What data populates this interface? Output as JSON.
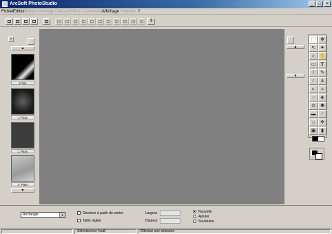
{
  "window": {
    "title": "ArcSoft PhotoStudio"
  },
  "menu": [
    {
      "label": "Fichier",
      "enabled": true
    },
    {
      "label": "Edition",
      "enabled": true
    },
    {
      "label": "Sélection",
      "enabled": false
    },
    {
      "label": "Image",
      "enabled": false
    },
    {
      "label": "Calques",
      "enabled": false
    },
    {
      "label": "Effets",
      "enabled": false
    },
    {
      "label": "Conversion",
      "enabled": false
    },
    {
      "label": "Affichage",
      "enabled": true
    },
    {
      "label": "Fenêtre",
      "enabled": false
    },
    {
      "label": "?",
      "enabled": true
    }
  ],
  "toolbar": {
    "help_label": "?"
  },
  "thumbnails": [
    {
      "label": "1 fois",
      "color": "#1a1a1a"
    },
    {
      "label": "1 Pxss",
      "color": "#2a2a2a"
    },
    {
      "label": "1 Pass",
      "color": "#3c3c3c"
    },
    {
      "label": "4. Pass",
      "color": "#b8b8b8"
    }
  ],
  "options": {
    "shape_select": "Rectangle",
    "draw_from_center": "Dessiner à partir du centre",
    "fixed_size": "Taille réglée",
    "width_label": "Largeur",
    "height_label": "Hauteur",
    "mode_new": "Nouvelle",
    "mode_add": "Ajouter",
    "mode_subtract": "Soustraire"
  },
  "status": {
    "tool": "Sélectionnez l'outil",
    "hint": "Effectue une sélection."
  },
  "colors": {
    "canvas": "#808080",
    "titlebar": "#0a246a"
  }
}
